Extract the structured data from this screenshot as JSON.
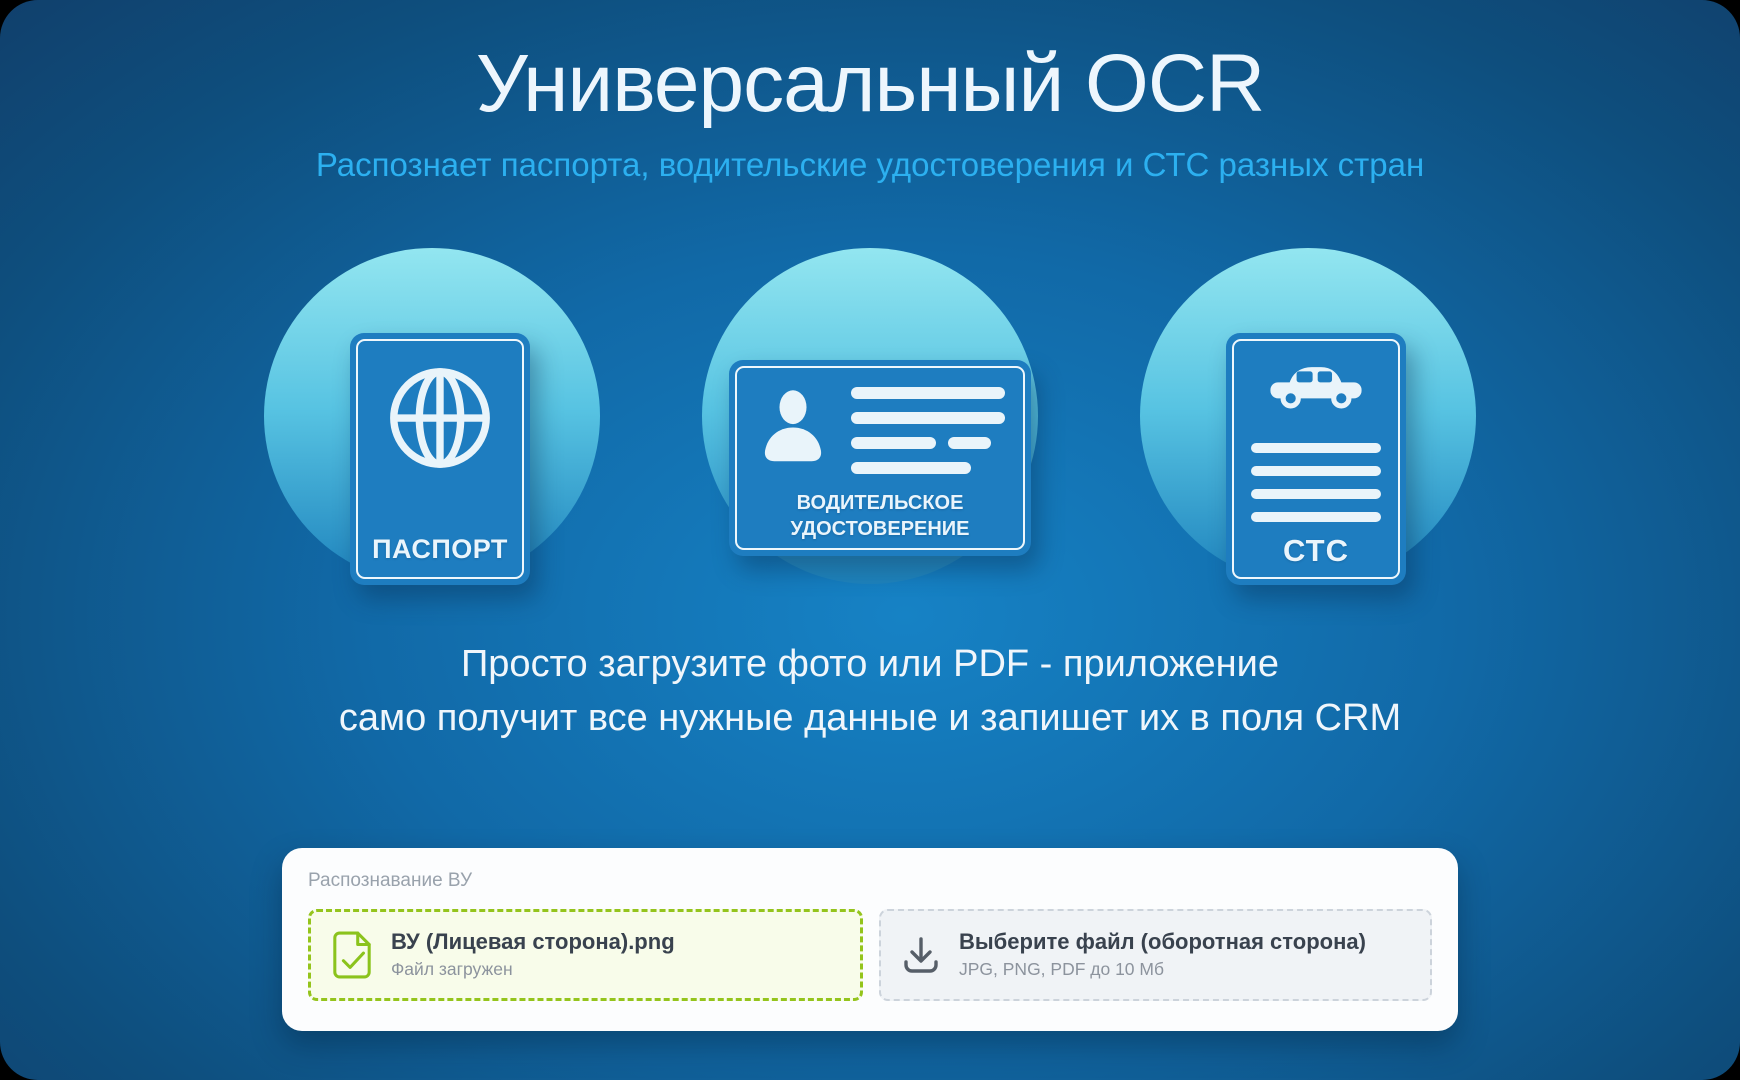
{
  "header": {
    "title": "Универсальный OCR",
    "subtitle": "Распознает паспорта, водительские удостоверения и СТС разных стран"
  },
  "features": {
    "passport": {
      "label": "ПАСПОРТ",
      "icon": "globe-icon"
    },
    "driver_license": {
      "label": "ВОДИТЕЛЬСКОЕ УДОСТОВЕРЕНИЕ",
      "icon": "person-icon"
    },
    "sts": {
      "label": "СТС",
      "icon": "car-icon"
    }
  },
  "description": {
    "line1": "Просто загрузите фото или PDF - приложение",
    "line2": "само получит все нужные данные и запишет их в поля CRM"
  },
  "upload_widget": {
    "header": "Распознавание ВУ",
    "uploaded_file": {
      "filename": "ВУ (Лицевая сторона).png",
      "status": "Файл загружен",
      "icon": "file-check-icon"
    },
    "file_chooser": {
      "label": "Выберите файл (оборотная сторона)",
      "hint": "JPG, PNG, PDF до 10 Мб",
      "icon": "download-icon"
    }
  },
  "colors": {
    "background_center": "#1682c5",
    "background_edge": "#113f6b",
    "subtitle_blue": "#2cb0f0",
    "circle_top": "#93e6f0",
    "circle_bottom": "#1e83bd",
    "doc_card_blue": "#1e7dc0",
    "success_green": "#94c41c"
  }
}
